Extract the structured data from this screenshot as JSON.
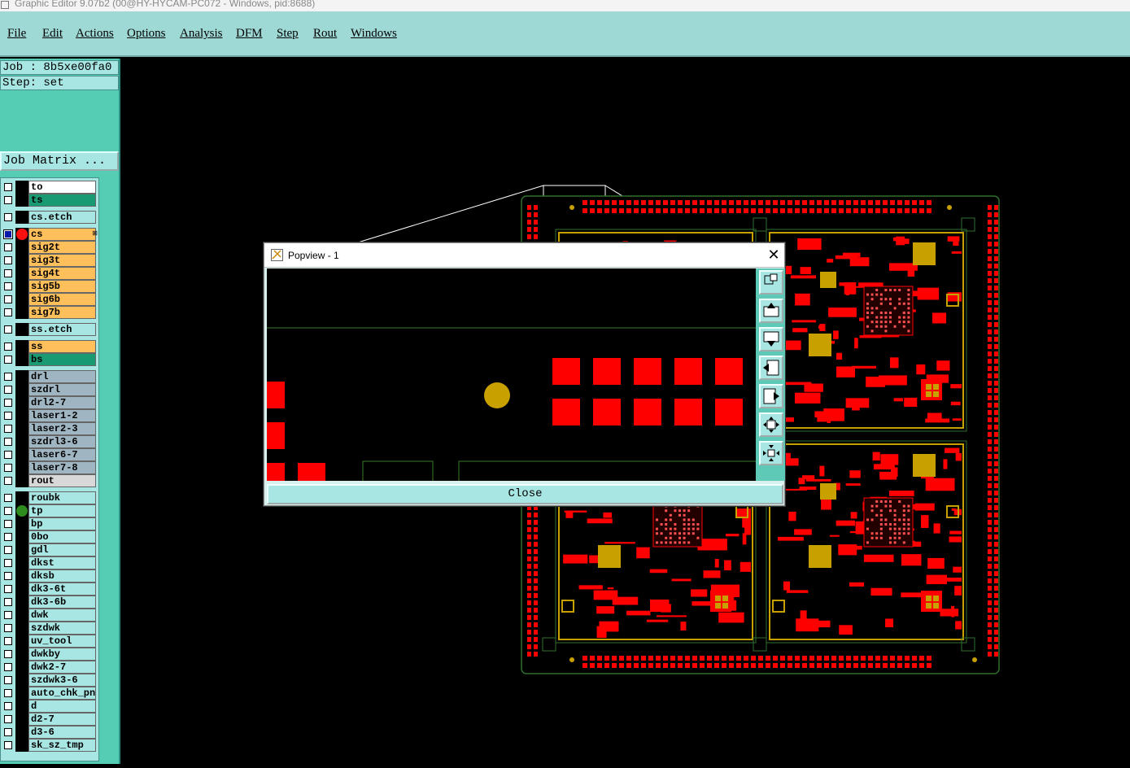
{
  "window": {
    "title": "Graphic Editor 9.07b2 (00@HY-HYCAM-PC072 - Windows, pid:8688)"
  },
  "menu": [
    {
      "label": "File",
      "name": "menu-file"
    },
    {
      "label": "Edit",
      "name": "menu-edit"
    },
    {
      "label": "Actions",
      "name": "menu-actions"
    },
    {
      "label": "Options",
      "name": "menu-options"
    },
    {
      "label": "Analysis",
      "name": "menu-analysis"
    },
    {
      "label": "DFM",
      "name": "menu-dfm"
    },
    {
      "label": "Step",
      "name": "menu-step"
    },
    {
      "label": "Rout",
      "name": "menu-rout"
    },
    {
      "label": "Windows",
      "name": "menu-windows"
    }
  ],
  "job": {
    "text": "Job : 8b5xe00fa0"
  },
  "step": {
    "text": "Step: set"
  },
  "job_matrix_button": "Job Matrix ...",
  "colors": {
    "panel_bg": "#55cdb4",
    "menubar_bg": "#9ed9d6",
    "copper_red": "#ff0000",
    "pad_gold": "#c8a000",
    "outline_green": "#2f6f2f",
    "layer_white": "#ffffff",
    "layer_green": "#1a9a73",
    "layer_light": "#a8e6e3",
    "layer_orange": "#ffbf5a",
    "layer_grey": "#9fb6c2",
    "layer_rout": "#d8d8d8"
  },
  "layers": [
    {
      "name": "to",
      "color": "#ffffff"
    },
    {
      "name": "ts",
      "color": "#1a9a73"
    },
    {
      "name": "cs.etch",
      "color": "#a8e6e3"
    },
    {
      "name": "cs",
      "color": "#ffbf5a",
      "active": true,
      "dot": "#ff1010",
      "tag": "⊞"
    },
    {
      "name": "sig2t",
      "color": "#ffbf5a"
    },
    {
      "name": "sig3t",
      "color": "#ffbf5a"
    },
    {
      "name": "sig4t",
      "color": "#ffbf5a"
    },
    {
      "name": "sig5b",
      "color": "#ffbf5a"
    },
    {
      "name": "sig6b",
      "color": "#ffbf5a"
    },
    {
      "name": "sig7b",
      "color": "#ffbf5a"
    },
    {
      "name": "ss.etch",
      "color": "#a8e6e3"
    },
    {
      "name": "ss",
      "color": "#ffbf5a"
    },
    {
      "name": "bs",
      "color": "#1a9a73"
    },
    {
      "name": "drl",
      "color": "#9fb6c2"
    },
    {
      "name": "szdrl",
      "color": "#9fb6c2"
    },
    {
      "name": "drl2-7",
      "color": "#9fb6c2"
    },
    {
      "name": "laser1-2",
      "color": "#9fb6c2"
    },
    {
      "name": "laser2-3",
      "color": "#9fb6c2"
    },
    {
      "name": "szdrl3-6",
      "color": "#9fb6c2"
    },
    {
      "name": "laser6-7",
      "color": "#9fb6c2"
    },
    {
      "name": "laser7-8",
      "color": "#9fb6c2"
    },
    {
      "name": "rout",
      "color": "#d8d8d8"
    },
    {
      "name": "roubk",
      "color": "#a8e6e3"
    },
    {
      "name": "tp",
      "color": "#a8e6e3",
      "dot": "#2e8b1e"
    },
    {
      "name": "bp",
      "color": "#a8e6e3"
    },
    {
      "name": "0bo",
      "color": "#a8e6e3"
    },
    {
      "name": "gdl",
      "color": "#a8e6e3"
    },
    {
      "name": "dkst",
      "color": "#a8e6e3"
    },
    {
      "name": "dksb",
      "color": "#a8e6e3"
    },
    {
      "name": "dk3-6t",
      "color": "#a8e6e3"
    },
    {
      "name": "dk3-6b",
      "color": "#a8e6e3"
    },
    {
      "name": "dwk",
      "color": "#a8e6e3"
    },
    {
      "name": "szdwk",
      "color": "#a8e6e3"
    },
    {
      "name": "uv_tool",
      "color": "#a8e6e3"
    },
    {
      "name": "dwkby",
      "color": "#a8e6e3"
    },
    {
      "name": "dwk2-7",
      "color": "#a8e6e3"
    },
    {
      "name": "szdwk3-6",
      "color": "#a8e6e3"
    },
    {
      "name": "auto_chk_pn",
      "color": "#a8e6e3"
    },
    {
      "name": "d",
      "color": "#a8e6e3"
    },
    {
      "name": "d2-7",
      "color": "#a8e6e3"
    },
    {
      "name": "d3-6",
      "color": "#a8e6e3"
    },
    {
      "name": "sk_sz_tmp",
      "color": "#a8e6e3"
    }
  ],
  "popview": {
    "title": "Popview - 1",
    "close_label": "Close",
    "tools": [
      "zoom-window-icon",
      "pan-up-icon",
      "pan-down-icon",
      "pan-left-icon",
      "pan-right-icon",
      "zoom-out-icon",
      "zoom-in-icon"
    ]
  }
}
